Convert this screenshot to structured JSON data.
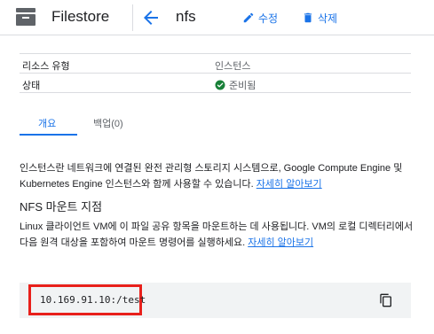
{
  "header": {
    "product_name": "Filestore",
    "page_title": "nfs",
    "edit_label": "수정",
    "delete_label": "삭제"
  },
  "info": {
    "rows": [
      {
        "key": "리소스 유형",
        "value": "인스턴스"
      },
      {
        "key": "상태",
        "value": "준비됨"
      }
    ]
  },
  "tabs": [
    {
      "label": "개요",
      "active": true
    },
    {
      "label": "백업(0)",
      "active": false
    }
  ],
  "overview": {
    "description": "인스턴스란 네트워크에 연결된 완전 관리형 스토리지 시스템으로, Google Compute Engine 및 Kubernetes Engine 인스턴스와 함께 사용할 수 있습니다.",
    "learn_more": "자세히 알아보기"
  },
  "mount": {
    "heading": "NFS 마운트 지점",
    "description": "Linux 클라이언트 VM에 이 파일 공유 항목을 마운트하는 데 사용됩니다. VM의 로컬 디렉터리에서 다음 원격 대상을 포함하여 마운트 명령어를 실행하세요.",
    "learn_more": "자세히 알아보기",
    "mount_point": "10.169.91.10:/test"
  },
  "colors": {
    "accent": "#1a73e8",
    "success": "#188038",
    "highlight": "#e8201b"
  },
  "icons": {
    "product": "filestore-icon",
    "back": "arrow-back-icon",
    "edit": "pencil-icon",
    "delete": "trash-icon",
    "status": "check-circle-icon",
    "copy": "copy-icon"
  }
}
